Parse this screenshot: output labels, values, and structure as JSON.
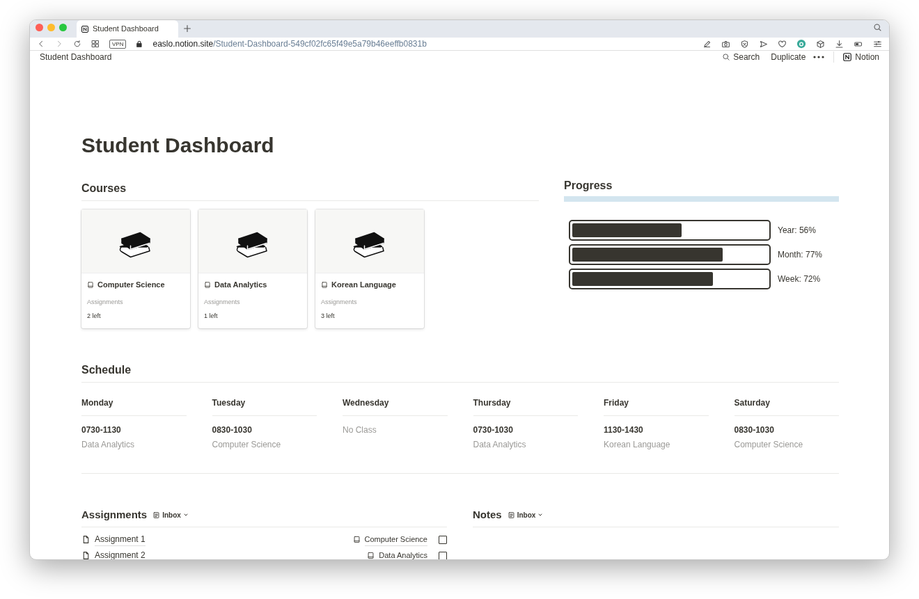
{
  "browser": {
    "tab_title": "Student Dashboard",
    "url_host": "easlo.notion.site",
    "url_path": "/Student-Dashboard-549cf02fc65f49e5a79b46eeffb0831b",
    "vpn_badge": "VPN"
  },
  "topbar": {
    "breadcrumb": "Student Dashboard",
    "search": "Search",
    "duplicate": "Duplicate",
    "brand": "Notion"
  },
  "page": {
    "title": "Student Dashboard"
  },
  "courses": {
    "heading": "Courses",
    "cards": [
      {
        "name": "Computer Science",
        "property": "Assignments",
        "value": "2 left"
      },
      {
        "name": "Data Analytics",
        "property": "Assignments",
        "value": "1 left"
      },
      {
        "name": "Korean Language",
        "property": "Assignments",
        "value": "3 left"
      }
    ]
  },
  "progress": {
    "heading": "Progress",
    "bars": [
      {
        "label": "Year: 56%",
        "level": 0.56
      },
      {
        "label": "Month: 77%",
        "level": 0.77
      },
      {
        "label": "Week: 72%",
        "level": 0.72
      }
    ]
  },
  "schedule": {
    "heading": "Schedule",
    "days": [
      {
        "day": "Monday",
        "time": "0730-1130",
        "course": "Data Analytics"
      },
      {
        "day": "Tuesday",
        "time": "0830-1030",
        "course": "Computer Science"
      },
      {
        "day": "Wednesday",
        "note": "No Class"
      },
      {
        "day": "Thursday",
        "time": "0730-1030",
        "course": "Data Analytics"
      },
      {
        "day": "Friday",
        "time": "1130-1430",
        "course": "Korean Language"
      },
      {
        "day": "Saturday",
        "time": "0830-1030",
        "course": "Computer Science"
      }
    ]
  },
  "assignments": {
    "heading": "Assignments",
    "view": "Inbox",
    "rows": [
      {
        "title": "Assignment 1",
        "course": "Computer Science",
        "done": false
      },
      {
        "title": "Assignment 2",
        "course": "Data Analytics",
        "done": false
      }
    ]
  },
  "notes": {
    "heading": "Notes",
    "view": "Inbox"
  }
}
